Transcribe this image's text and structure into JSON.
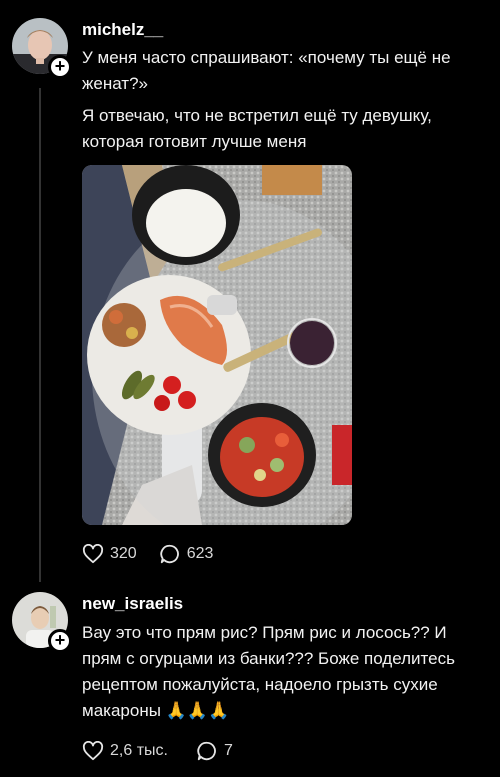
{
  "posts": [
    {
      "username": "michelz__",
      "paragraphs": [
        "У меня часто спрашивают: «почему ты ещё не женат?»",
        "Я отвечаю, что не встретил ещё ту девушку, которая готовит лучше меня"
      ],
      "likes": "320",
      "comments": "623",
      "image_alt": "Food photo"
    },
    {
      "username": "new_israelis",
      "text": "Вау это что прям рис? Прям рис и лосось?? И прям с огурцами из банки??? Боже поделитесь рецептом пожалуйста, надоело грызть сухие макароны 🙏🙏🙏",
      "likes": "2,6 тыс.",
      "comments": "7"
    }
  ],
  "icons": {
    "like": "heart-icon",
    "comment": "comment-bubble-icon",
    "follow": "plus-icon"
  },
  "colors": {
    "background": "#000000",
    "text": "#f5f5f5",
    "thread_line": "#333333"
  }
}
